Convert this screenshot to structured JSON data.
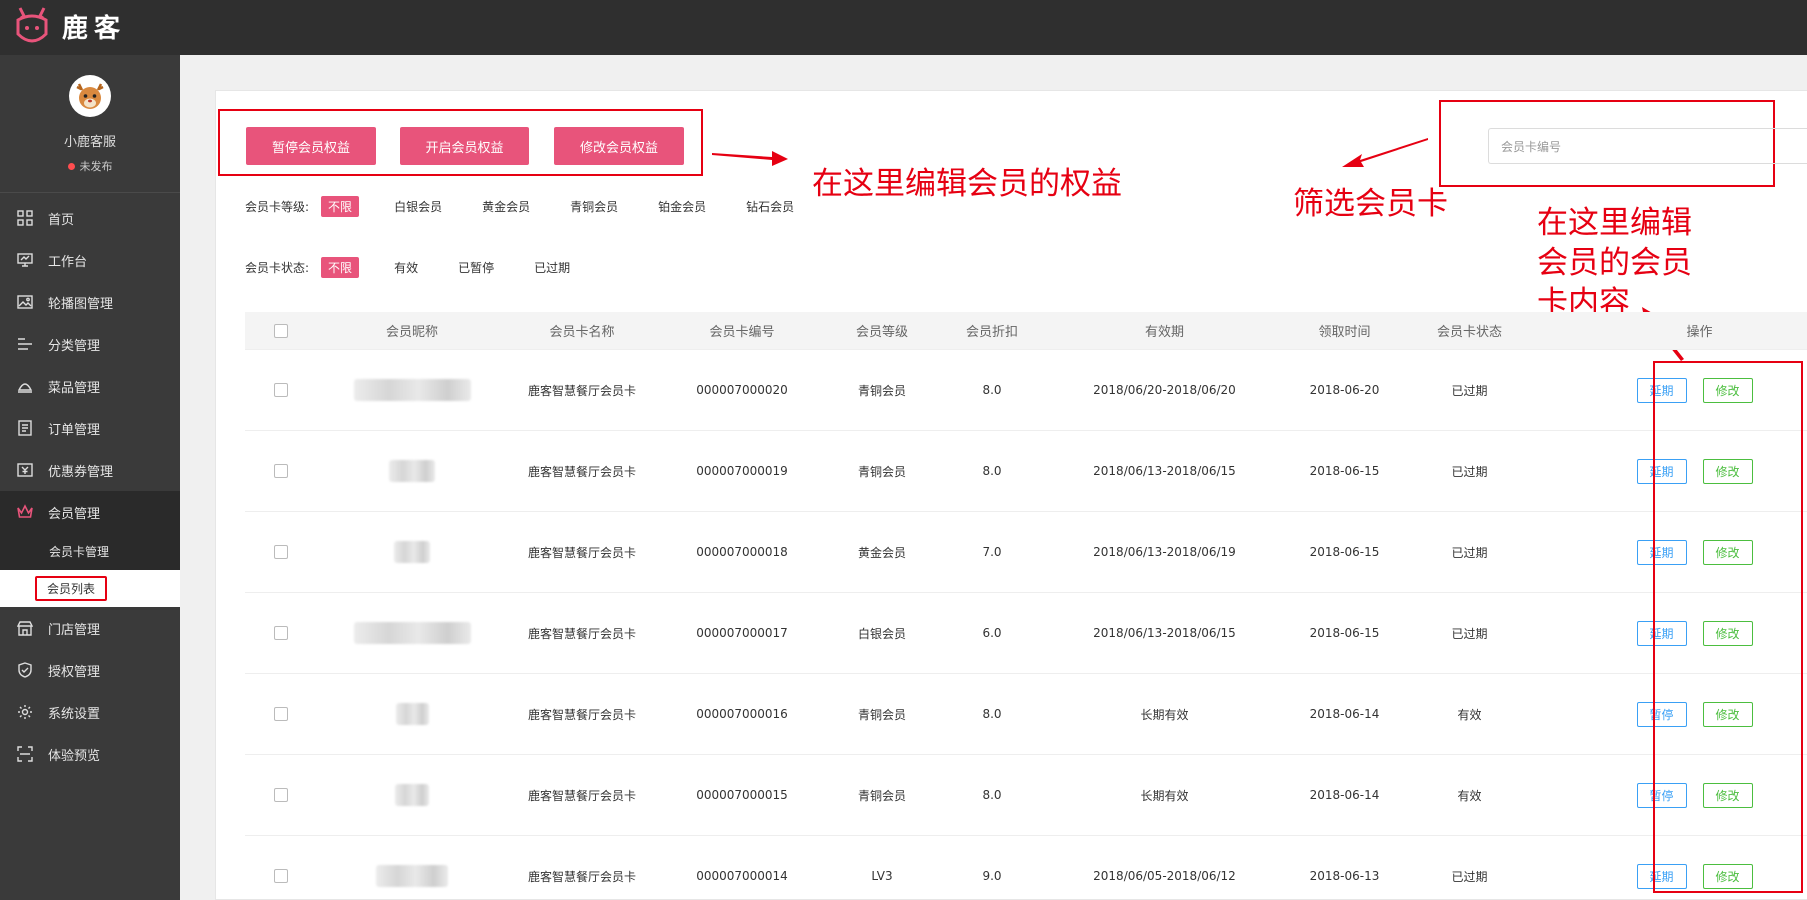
{
  "brand": {
    "name": "鹿客",
    "accent": "#e8547b",
    "annotation_color": "#e60012"
  },
  "profile": {
    "name": "小鹿客服",
    "status": "未发布"
  },
  "nav": [
    {
      "label": "首页",
      "icon": "grid-icon"
    },
    {
      "label": "工作台",
      "icon": "monitor-icon"
    },
    {
      "label": "轮播图管理",
      "icon": "image-icon"
    },
    {
      "label": "分类管理",
      "icon": "list-icon"
    },
    {
      "label": "菜品管理",
      "icon": "dish-icon"
    },
    {
      "label": "订单管理",
      "icon": "document-icon"
    },
    {
      "label": "优惠券管理",
      "icon": "coupon-icon"
    },
    {
      "label": "会员管理",
      "icon": "crown-icon",
      "active": true
    },
    {
      "label": "门店管理",
      "icon": "store-icon"
    },
    {
      "label": "授权管理",
      "icon": "shield-icon"
    },
    {
      "label": "系统设置",
      "icon": "gear-icon"
    },
    {
      "label": "体验预览",
      "icon": "scan-icon"
    }
  ],
  "subnav": [
    {
      "label": "会员卡管理"
    },
    {
      "label": "会员列表",
      "selected": true
    }
  ],
  "actions": {
    "pause": "暂停会员权益",
    "open": "开启会员权益",
    "edit": "修改会员权益"
  },
  "annotations": {
    "rights": "在这里编辑会员的权益",
    "filter": "筛选会员卡",
    "card": "在这里编辑\n会员的会员\n卡内容"
  },
  "search": {
    "placeholder": "会员卡编号"
  },
  "filters": {
    "level": {
      "label": "会员卡等级:",
      "options": [
        "不限",
        "白银会员",
        "黄金会员",
        "青铜会员",
        "铂金会员",
        "钻石会员"
      ],
      "selected": "不限"
    },
    "status": {
      "label": "会员卡状态:",
      "options": [
        "不限",
        "有效",
        "已暂停",
        "已过期"
      ],
      "selected": "不限"
    }
  },
  "table": {
    "headers": [
      "会员昵称",
      "会员卡名称",
      "会员卡编号",
      "会员等级",
      "会员折扣",
      "有效期",
      "领取时间",
      "会员卡状态",
      "操作"
    ],
    "rows": [
      {
        "card_name": "鹿客智慧餐厅会员卡",
        "card_no": "000007000020",
        "level": "青铜会员",
        "discount": "8.0",
        "validity": "2018/06/20-2018/06/20",
        "received": "2018-06-20",
        "status": "已过期",
        "op1": "延期",
        "op2": "修改",
        "blur_width": 0.9
      },
      {
        "card_name": "鹿客智慧餐厅会员卡",
        "card_no": "000007000019",
        "level": "青铜会员",
        "discount": "8.0",
        "validity": "2018/06/13-2018/06/15",
        "received": "2018-06-15",
        "status": "已过期",
        "op1": "延期",
        "op2": "修改",
        "blur_width": 0.35
      },
      {
        "card_name": "鹿客智慧餐厅会员卡",
        "card_no": "000007000018",
        "level": "黄金会员",
        "discount": "7.0",
        "validity": "2018/06/13-2018/06/19",
        "received": "2018-06-15",
        "status": "已过期",
        "op1": "延期",
        "op2": "修改",
        "blur_width": 0.28
      },
      {
        "card_name": "鹿客智慧餐厅会员卡",
        "card_no": "000007000017",
        "level": "白银会员",
        "discount": "6.0",
        "validity": "2018/06/13-2018/06/15",
        "received": "2018-06-15",
        "status": "已过期",
        "op1": "延期",
        "op2": "修改",
        "blur_width": 0.9
      },
      {
        "card_name": "鹿客智慧餐厅会员卡",
        "card_no": "000007000016",
        "level": "青铜会员",
        "discount": "8.0",
        "validity": "长期有效",
        "received": "2018-06-14",
        "status": "有效",
        "op1": "暂停",
        "op2": "修改",
        "blur_width": 0.25
      },
      {
        "card_name": "鹿客智慧餐厅会员卡",
        "card_no": "000007000015",
        "level": "青铜会员",
        "discount": "8.0",
        "validity": "长期有效",
        "received": "2018-06-14",
        "status": "有效",
        "op1": "暂停",
        "op2": "修改",
        "blur_width": 0.26
      },
      {
        "card_name": "鹿客智慧餐厅会员卡",
        "card_no": "000007000014",
        "level": "LV3",
        "discount": "9.0",
        "validity": "2018/06/05-2018/06/12",
        "received": "2018-06-13",
        "status": "已过期",
        "op1": "延期",
        "op2": "修改",
        "blur_width": 0.55
      }
    ]
  }
}
